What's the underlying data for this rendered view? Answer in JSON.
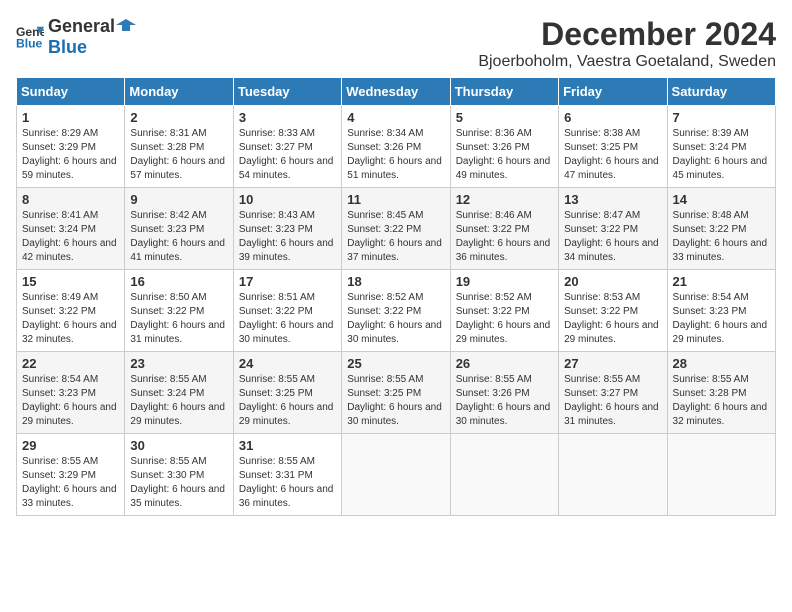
{
  "header": {
    "logo_general": "General",
    "logo_blue": "Blue",
    "title": "December 2024",
    "subtitle": "Bjoerboholm, Vaestra Goetaland, Sweden"
  },
  "weekdays": [
    "Sunday",
    "Monday",
    "Tuesday",
    "Wednesday",
    "Thursday",
    "Friday",
    "Saturday"
  ],
  "weeks": [
    [
      {
        "day": "1",
        "sunrise": "8:29 AM",
        "sunset": "3:29 PM",
        "daylight": "6 hours and 59 minutes."
      },
      {
        "day": "2",
        "sunrise": "8:31 AM",
        "sunset": "3:28 PM",
        "daylight": "6 hours and 57 minutes."
      },
      {
        "day": "3",
        "sunrise": "8:33 AM",
        "sunset": "3:27 PM",
        "daylight": "6 hours and 54 minutes."
      },
      {
        "day": "4",
        "sunrise": "8:34 AM",
        "sunset": "3:26 PM",
        "daylight": "6 hours and 51 minutes."
      },
      {
        "day": "5",
        "sunrise": "8:36 AM",
        "sunset": "3:26 PM",
        "daylight": "6 hours and 49 minutes."
      },
      {
        "day": "6",
        "sunrise": "8:38 AM",
        "sunset": "3:25 PM",
        "daylight": "6 hours and 47 minutes."
      },
      {
        "day": "7",
        "sunrise": "8:39 AM",
        "sunset": "3:24 PM",
        "daylight": "6 hours and 45 minutes."
      }
    ],
    [
      {
        "day": "8",
        "sunrise": "8:41 AM",
        "sunset": "3:24 PM",
        "daylight": "6 hours and 42 minutes."
      },
      {
        "day": "9",
        "sunrise": "8:42 AM",
        "sunset": "3:23 PM",
        "daylight": "6 hours and 41 minutes."
      },
      {
        "day": "10",
        "sunrise": "8:43 AM",
        "sunset": "3:23 PM",
        "daylight": "6 hours and 39 minutes."
      },
      {
        "day": "11",
        "sunrise": "8:45 AM",
        "sunset": "3:22 PM",
        "daylight": "6 hours and 37 minutes."
      },
      {
        "day": "12",
        "sunrise": "8:46 AM",
        "sunset": "3:22 PM",
        "daylight": "6 hours and 36 minutes."
      },
      {
        "day": "13",
        "sunrise": "8:47 AM",
        "sunset": "3:22 PM",
        "daylight": "6 hours and 34 minutes."
      },
      {
        "day": "14",
        "sunrise": "8:48 AM",
        "sunset": "3:22 PM",
        "daylight": "6 hours and 33 minutes."
      }
    ],
    [
      {
        "day": "15",
        "sunrise": "8:49 AM",
        "sunset": "3:22 PM",
        "daylight": "6 hours and 32 minutes."
      },
      {
        "day": "16",
        "sunrise": "8:50 AM",
        "sunset": "3:22 PM",
        "daylight": "6 hours and 31 minutes."
      },
      {
        "day": "17",
        "sunrise": "8:51 AM",
        "sunset": "3:22 PM",
        "daylight": "6 hours and 30 minutes."
      },
      {
        "day": "18",
        "sunrise": "8:52 AM",
        "sunset": "3:22 PM",
        "daylight": "6 hours and 30 minutes."
      },
      {
        "day": "19",
        "sunrise": "8:52 AM",
        "sunset": "3:22 PM",
        "daylight": "6 hours and 29 minutes."
      },
      {
        "day": "20",
        "sunrise": "8:53 AM",
        "sunset": "3:22 PM",
        "daylight": "6 hours and 29 minutes."
      },
      {
        "day": "21",
        "sunrise": "8:54 AM",
        "sunset": "3:23 PM",
        "daylight": "6 hours and 29 minutes."
      }
    ],
    [
      {
        "day": "22",
        "sunrise": "8:54 AM",
        "sunset": "3:23 PM",
        "daylight": "6 hours and 29 minutes."
      },
      {
        "day": "23",
        "sunrise": "8:55 AM",
        "sunset": "3:24 PM",
        "daylight": "6 hours and 29 minutes."
      },
      {
        "day": "24",
        "sunrise": "8:55 AM",
        "sunset": "3:25 PM",
        "daylight": "6 hours and 29 minutes."
      },
      {
        "day": "25",
        "sunrise": "8:55 AM",
        "sunset": "3:25 PM",
        "daylight": "6 hours and 30 minutes."
      },
      {
        "day": "26",
        "sunrise": "8:55 AM",
        "sunset": "3:26 PM",
        "daylight": "6 hours and 30 minutes."
      },
      {
        "day": "27",
        "sunrise": "8:55 AM",
        "sunset": "3:27 PM",
        "daylight": "6 hours and 31 minutes."
      },
      {
        "day": "28",
        "sunrise": "8:55 AM",
        "sunset": "3:28 PM",
        "daylight": "6 hours and 32 minutes."
      }
    ],
    [
      {
        "day": "29",
        "sunrise": "8:55 AM",
        "sunset": "3:29 PM",
        "daylight": "6 hours and 33 minutes."
      },
      {
        "day": "30",
        "sunrise": "8:55 AM",
        "sunset": "3:30 PM",
        "daylight": "6 hours and 35 minutes."
      },
      {
        "day": "31",
        "sunrise": "8:55 AM",
        "sunset": "3:31 PM",
        "daylight": "6 hours and 36 minutes."
      },
      null,
      null,
      null,
      null
    ]
  ],
  "labels": {
    "sunrise": "Sunrise:",
    "sunset": "Sunset:",
    "daylight": "Daylight:"
  }
}
